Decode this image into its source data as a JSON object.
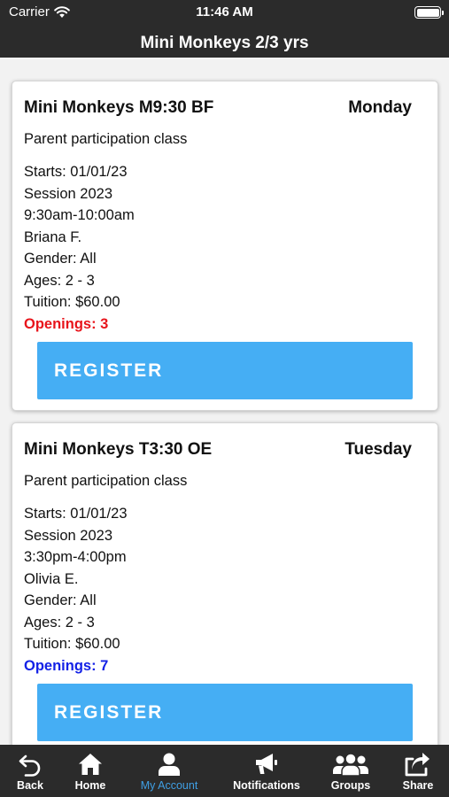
{
  "status_bar": {
    "carrier": "Carrier",
    "time": "11:46 AM"
  },
  "nav": {
    "title": "Mini Monkeys 2/3 yrs"
  },
  "classes": [
    {
      "name": "Mini Monkeys M9:30 BF",
      "day": "Monday",
      "description": "Parent participation class",
      "starts": "Starts: 01/01/23",
      "session": "Session 2023",
      "time": "9:30am-10:00am",
      "instructor": "Briana F.",
      "gender": "Gender: All",
      "ages": "Ages: 2 - 3",
      "tuition": "Tuition: $60.00",
      "openings": "Openings: 3",
      "openings_color": "#e8141b",
      "register_label": "REGISTER"
    },
    {
      "name": "Mini Monkeys T3:30 OE",
      "day": "Tuesday",
      "description": "Parent participation class",
      "starts": "Starts: 01/01/23",
      "session": "Session 2023",
      "time": "3:30pm-4:00pm",
      "instructor": "Olivia E.",
      "gender": "Gender: All",
      "ages": "Ages: 2 - 3",
      "tuition": "Tuition: $60.00",
      "openings": "Openings: 7",
      "openings_color": "#1422e6",
      "register_label": "REGISTER"
    }
  ],
  "tabbar": {
    "items": [
      {
        "label": "Back",
        "icon": "back-arrow-icon"
      },
      {
        "label": "Home",
        "icon": "home-icon"
      },
      {
        "label": "My Account",
        "icon": "user-icon",
        "active": true
      },
      {
        "label": "Notifications",
        "icon": "megaphone-icon"
      },
      {
        "label": "Groups",
        "icon": "group-icon"
      },
      {
        "label": "Share",
        "icon": "share-icon"
      }
    ]
  },
  "colors": {
    "bar_background": "#2b2b2b",
    "register_button": "#45aef4",
    "active_tab": "#3f9fe4"
  }
}
